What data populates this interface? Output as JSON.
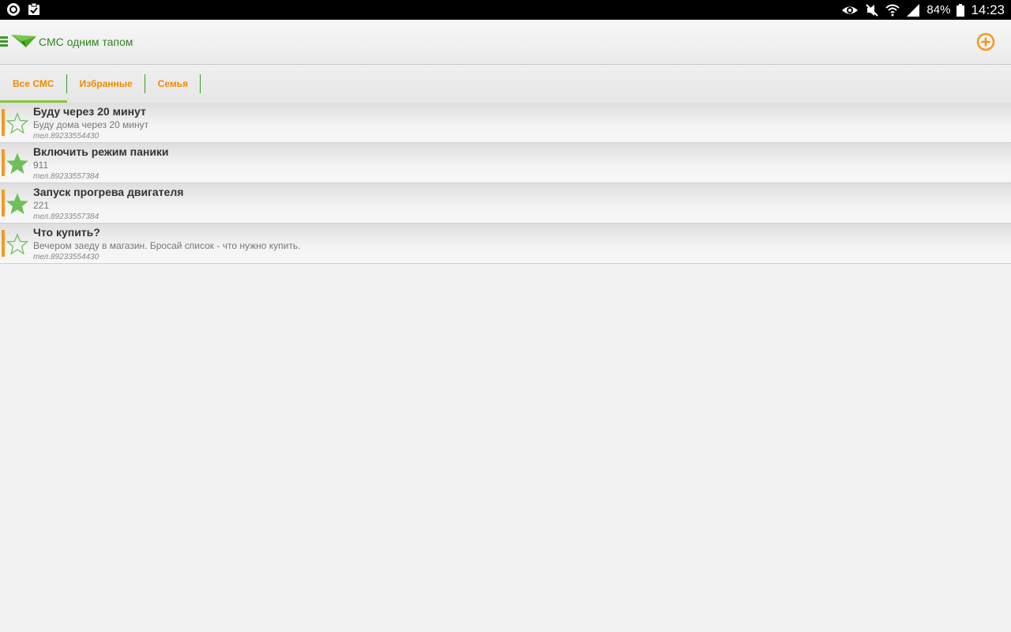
{
  "status_bar": {
    "left_icons": [
      "shield-app-icon",
      "clipboard-icon"
    ],
    "right_icons": [
      "eye-icon",
      "mute-icon",
      "wifi-icon",
      "signal-icon"
    ],
    "battery": "84%",
    "time": "14:23"
  },
  "app_bar": {
    "title": "СМС одним тапом",
    "menu_icon": "menu-icon",
    "logo_icon": "paper-plane-icon",
    "add_icon": "add-circle-icon",
    "accent_color": "#f08a00",
    "brand_color": "#2a8a1a"
  },
  "tabs": [
    {
      "label": "Все СМС",
      "active": true
    },
    {
      "label": "Избранные",
      "active": false
    },
    {
      "label": "Семья",
      "active": false
    }
  ],
  "messages": [
    {
      "title": "Буду через 20 минут",
      "body": "Буду дома через 20 минут",
      "phone": "тел.89233554430",
      "favorite": false
    },
    {
      "title": "Включить режим паники",
      "body": "911",
      "phone": "тел.89233557384",
      "favorite": true
    },
    {
      "title": "Запуск прогрева двигателя",
      "body": "221",
      "phone": "тел.89233557384",
      "favorite": true
    },
    {
      "title": "Что купить?",
      "body": "Вечером заеду в магазин. Бросай список - что нужно купить.",
      "phone": "тел.89233554430",
      "favorite": false
    }
  ]
}
